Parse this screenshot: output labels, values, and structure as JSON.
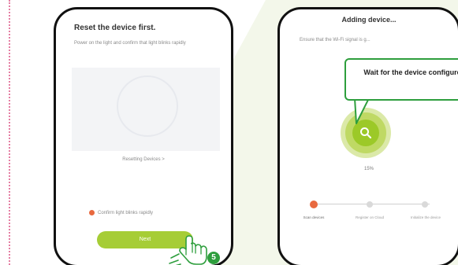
{
  "left_screen": {
    "title": "Reset the device first.",
    "subtitle": "Power on the light and confirm that light blinks rapidly",
    "status": "Resetting Devices >",
    "confirm_label": "Confirm light blinks rapidly",
    "next_label": "Next",
    "step_number": "5"
  },
  "right_screen": {
    "title": "Adding device...",
    "subtitle": "Ensure that the Wi-Fi signal is g...",
    "callout_text": "Wait for the device configure",
    "progress_percent": "15%",
    "progress_value": 0.15,
    "steps": [
      {
        "label": "Scan devices",
        "state": "active"
      },
      {
        "label": "Register on Cloud",
        "state": "pending"
      },
      {
        "label": "Initialize the device",
        "state": "pending"
      }
    ]
  },
  "colors": {
    "accent_green": "#a6cd36",
    "step_badge_green": "#2e9e3d",
    "active_dot": "#e8693f",
    "frame": "#111111"
  },
  "icons": {
    "hand": "pointing-hand-icon",
    "scan": "search-icon"
  }
}
